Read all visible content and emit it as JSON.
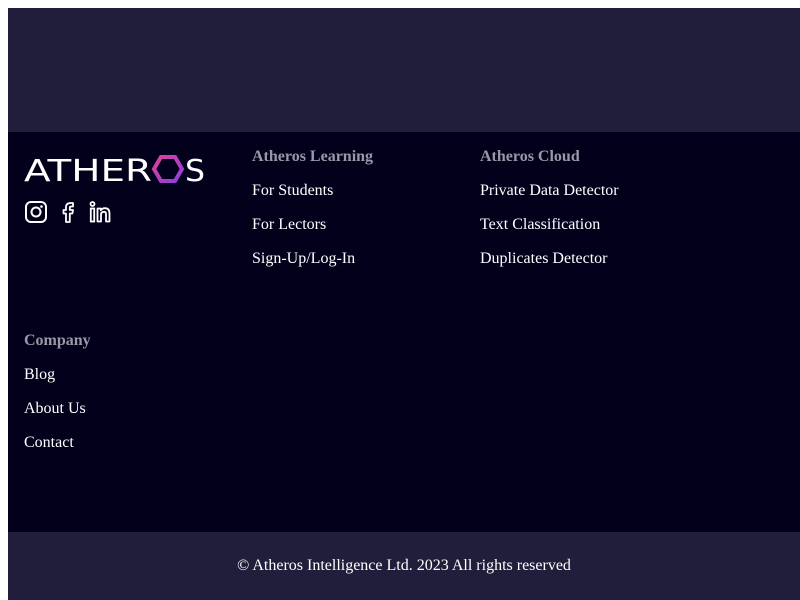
{
  "brand": {
    "name": "ATHEROS",
    "letters_white_a": "ATHER",
    "letter_accent": "O",
    "letter_white_b": "S"
  },
  "socials": [
    {
      "icon": "instagram-icon",
      "label": "Instagram"
    },
    {
      "icon": "facebook-icon",
      "label": "Facebook"
    },
    {
      "icon": "linkedin-icon",
      "label": "LinkedIn"
    }
  ],
  "columns": {
    "learning": {
      "heading": "Atheros Learning",
      "links": [
        "For Students",
        "For Lectors",
        "Sign-Up/Log-In"
      ]
    },
    "cloud": {
      "heading": "Atheros Cloud",
      "links": [
        "Private Data Detector",
        "Text Classification",
        "Duplicates Detector"
      ]
    },
    "company": {
      "heading": "Company",
      "links": [
        "Blog",
        "About Us",
        "Contact"
      ]
    }
  },
  "copyright": "© Atheros Intelligence Ltd. 2023 All rights reserved",
  "colors": {
    "band": "#211e3b",
    "footer_bg": "#03001c",
    "heading": "#9a98a6",
    "accent_from": "#e0409a",
    "accent_to": "#8a3fe0"
  }
}
